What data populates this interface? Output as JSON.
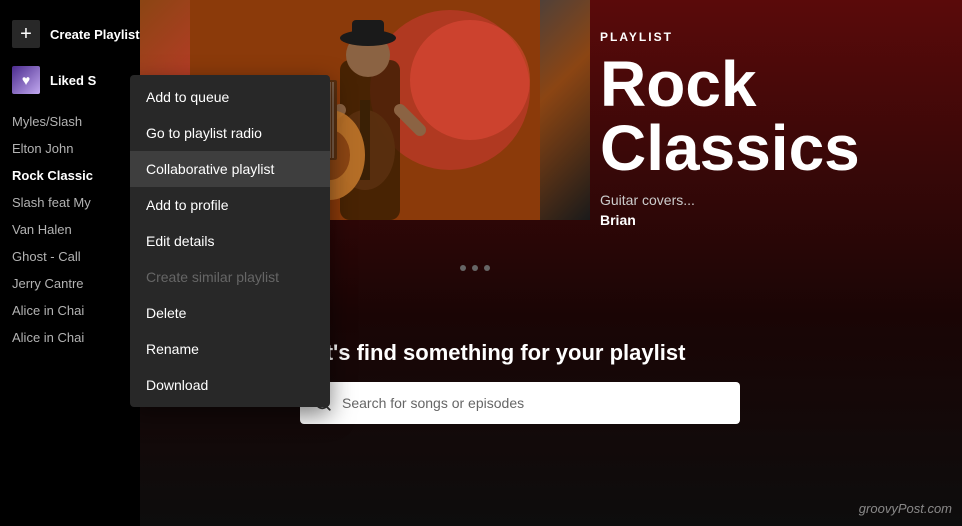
{
  "sidebar": {
    "create_playlist_label": "Create Playlist",
    "liked_label": "Liked S",
    "items": [
      {
        "label": "Myles/Slash",
        "active": false
      },
      {
        "label": "Elton John",
        "active": false
      },
      {
        "label": "Rock Classic",
        "active": true
      },
      {
        "label": "Slash feat My",
        "active": false
      },
      {
        "label": "Van Halen",
        "active": false
      },
      {
        "label": "Ghost - Call",
        "active": false
      },
      {
        "label": "Jerry Cantre",
        "active": false
      },
      {
        "label": "Alice in Chai",
        "active": false
      },
      {
        "label": "Alice in Chai",
        "active": false
      }
    ]
  },
  "playlist": {
    "type_label": "PLAYLIST",
    "title": "Rock Classics",
    "description": "Guitar covers...",
    "author": "Brian"
  },
  "context_menu": {
    "items": [
      {
        "label": "Add to queue",
        "disabled": false,
        "active": false
      },
      {
        "label": "Go to playlist radio",
        "disabled": false,
        "active": false
      },
      {
        "label": "Collaborative playlist",
        "disabled": false,
        "active": true
      },
      {
        "label": "Add to profile",
        "disabled": false,
        "active": false
      },
      {
        "label": "Edit details",
        "disabled": false,
        "active": false
      },
      {
        "label": "Create similar playlist",
        "disabled": true,
        "active": false
      },
      {
        "label": "Delete",
        "disabled": false,
        "active": false
      },
      {
        "label": "Rename",
        "disabled": false,
        "active": false
      },
      {
        "label": "Download",
        "disabled": false,
        "active": false
      }
    ]
  },
  "find_section": {
    "title": "et's find something for your playlist",
    "search_placeholder": "Search for songs or episodes"
  },
  "watermark": "groovyPost.com"
}
